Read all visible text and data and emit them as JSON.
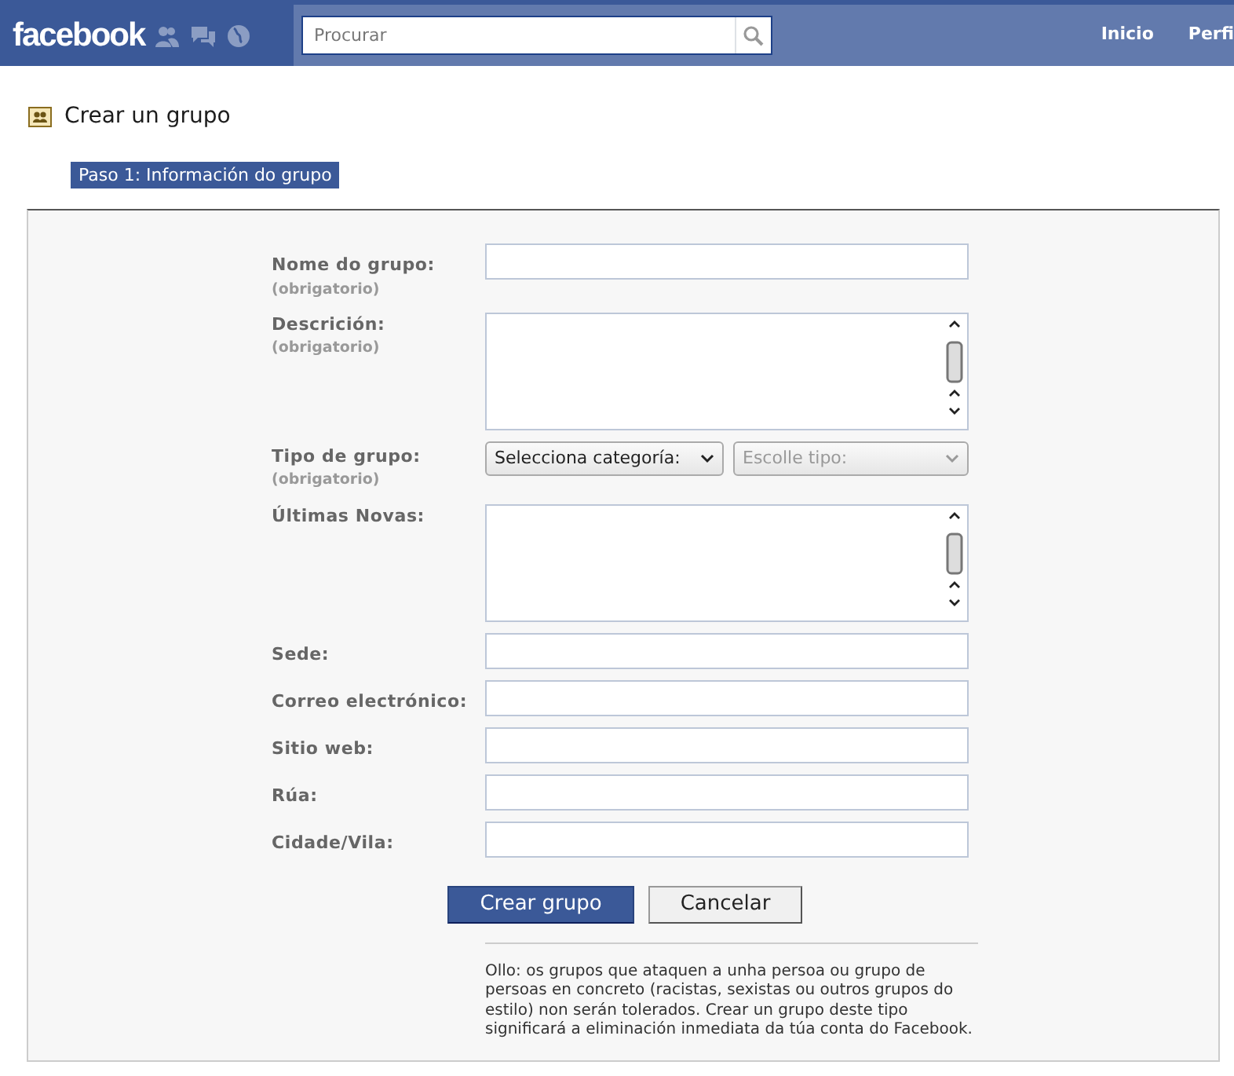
{
  "topbar": {
    "logo": "facebook",
    "search": {
      "placeholder": "Procurar"
    },
    "nav": [
      "Inicio",
      "Perfi"
    ]
  },
  "page_title": "Crear un grupo",
  "step": {
    "label": "Paso 1: Información do grupo",
    "selected": true
  },
  "fields": [
    {
      "kind": "text",
      "label": "Nome do grupo:",
      "note": "(obrigatorio)"
    },
    {
      "kind": "textarea",
      "label": "Descrición:",
      "note": "(obrigatorio)"
    },
    {
      "kind": "select",
      "label": "Tipo de grupo:",
      "note": "(obrigatorio)",
      "selects": [
        {
          "text": "Selecciona categoría:",
          "disabled": false
        },
        {
          "text": "Escolle tipo:",
          "disabled": true
        }
      ]
    },
    {
      "kind": "textarea",
      "label": "Últimas Novas:"
    },
    {
      "kind": "text",
      "label": "Sede:"
    },
    {
      "kind": "text",
      "label": "Correo electrónico:"
    },
    {
      "kind": "text",
      "label": "Sitio web:"
    },
    {
      "kind": "text",
      "label": "Rúa:"
    },
    {
      "kind": "text",
      "label": "Cidade/Vila:"
    }
  ],
  "buttons": [
    {
      "label": "Crear grupo",
      "kind": "primary"
    },
    {
      "label": "Cancelar",
      "kind": "secondary"
    }
  ],
  "note": "Ollo: os grupos que ataquen a unha persoa ou grupo de persoas en concreto (racistas, sexistas ou outros grupos do estilo) non serán tolerados. Crear un grupo deste tipo significará a eliminación inmediata da túa conta do Facebook."
}
